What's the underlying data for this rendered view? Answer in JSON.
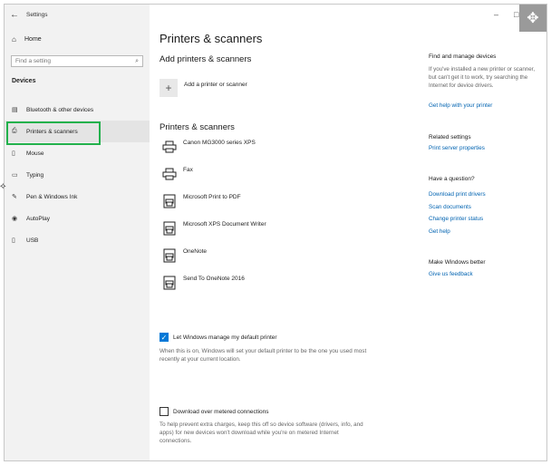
{
  "window": {
    "title": "Settings",
    "back_glyph": "←",
    "minimize_glyph": "–",
    "maximize_glyph": "□"
  },
  "sidebar": {
    "home": {
      "icon": "home-icon",
      "label": "Home"
    },
    "search": {
      "placeholder": "Find a setting",
      "icon": "search-icon"
    },
    "section": "Devices",
    "items": [
      {
        "icon": "bluetooth-devices-icon",
        "label": "Bluetooth & other devices",
        "active": false
      },
      {
        "icon": "printer-icon",
        "label": "Printers & scanners",
        "active": true
      },
      {
        "icon": "mouse-icon",
        "label": "Mouse",
        "active": false
      },
      {
        "icon": "keyboard-icon",
        "label": "Typing",
        "active": false
      },
      {
        "icon": "pen-icon",
        "label": "Pen & Windows Ink",
        "active": false
      },
      {
        "icon": "autoplay-icon",
        "label": "AutoPlay",
        "active": false
      },
      {
        "icon": "usb-icon",
        "label": "USB",
        "active": false
      }
    ]
  },
  "main": {
    "title": "Printers & scanners",
    "add_section_title": "Add printers & scanners",
    "add_button_label": "Add a printer or scanner",
    "list_title": "Printers & scanners",
    "printers": [
      {
        "name": "Canon MG3000 series XPS",
        "icon": "printer-icon"
      },
      {
        "name": "Fax",
        "icon": "printer-icon"
      },
      {
        "name": "Microsoft Print to PDF",
        "icon": "document-printer-icon"
      },
      {
        "name": "Microsoft XPS Document Writer",
        "icon": "document-printer-icon"
      },
      {
        "name": "OneNote",
        "icon": "document-printer-icon"
      },
      {
        "name": "Send To OneNote 2016",
        "icon": "document-printer-icon"
      }
    ],
    "default_printer": {
      "checked": true,
      "label": "Let Windows manage my default printer",
      "help": "When this is on, Windows will set your default printer to be the one you used most recently at your current location."
    },
    "metered": {
      "checked": false,
      "label": "Download over metered connections",
      "help": "To help prevent extra charges, keep this off so device software (drivers, info, and apps) for new devices won't download while you're on metered Internet connections."
    }
  },
  "right": {
    "find_head": "Find and manage devices",
    "find_text": "If you've installed a new printer or scanner, but can't get it to work, try searching the Internet for device drivers.",
    "find_link": "Get help with your printer",
    "related_head": "Related settings",
    "related_link": "Print server properties",
    "question_head": "Have a question?",
    "question_links": [
      "Download print drivers",
      "Scan documents",
      "Change printer status",
      "Get help"
    ],
    "better_head": "Make Windows better",
    "better_link": "Give us feedback"
  },
  "colors": {
    "accent": "#0078d7",
    "link": "#0063b1",
    "highlight": "#22b14c",
    "sidebar_bg": "#f2f2f2"
  }
}
